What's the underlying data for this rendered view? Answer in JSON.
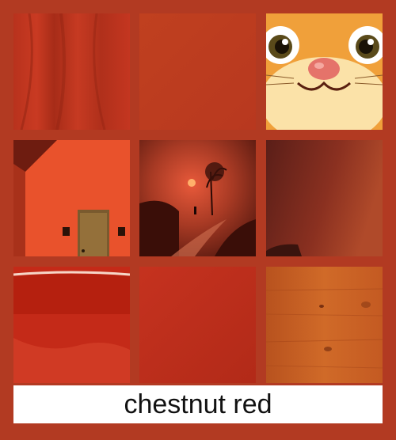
{
  "caption": "chestnut red",
  "colors": {
    "background": "#b23a22",
    "caption_bg": "#ffffff",
    "caption_text": "#111111"
  },
  "tiles": [
    {
      "name": "red-fabric-drape"
    },
    {
      "name": "flat-red-texture"
    },
    {
      "name": "cartoon-cat-face"
    },
    {
      "name": "red-house-wall-door"
    },
    {
      "name": "misty-sunset-path"
    },
    {
      "name": "dark-red-gradient"
    },
    {
      "name": "glossy-red-wave"
    },
    {
      "name": "plain-red-square"
    },
    {
      "name": "red-wood-grain"
    }
  ]
}
